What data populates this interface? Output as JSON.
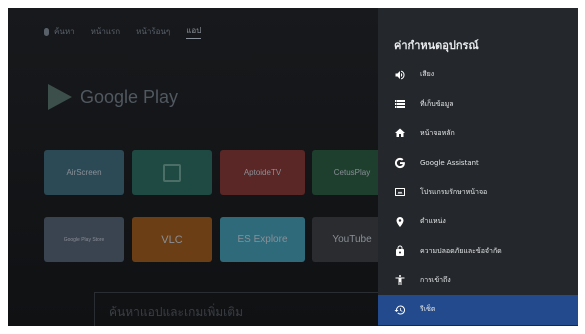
{
  "home": {
    "nav": {
      "search": "ค้นหา",
      "tabs": [
        "หน้าแรก",
        "หน้าร้อนๆ",
        "แอป"
      ]
    },
    "store_title": "Google Play",
    "apps_row1": [
      {
        "name": "AirScreen",
        "color": "#2c4a55"
      },
      {
        "name": "",
        "color": "#1f4a44"
      },
      {
        "name": "AptoideTV",
        "color": "#5a2626"
      },
      {
        "name": "CetusPlay",
        "color": "#1e3e2e"
      }
    ],
    "apps_row2": [
      {
        "name": "Google Play Store",
        "color": "#3a4350"
      },
      {
        "name": "VLC",
        "color": "#6b3e15"
      },
      {
        "name": "ES Explore",
        "color": "#2f6a7a"
      },
      {
        "name": "YouTube",
        "color": "#2a2c30"
      }
    ],
    "bottom_search": "ค้นหาแอปและเกมเพิ่มเติม"
  },
  "panel": {
    "title": "ค่ากำหนดอุปกรณ์",
    "items": [
      {
        "label": "เสียง",
        "icon": "speaker-icon"
      },
      {
        "label": "ที่เก็บข้อมูล",
        "icon": "storage-icon"
      },
      {
        "label": "หน้าจอหลัก",
        "icon": "home-icon"
      },
      {
        "label": "Google Assistant",
        "icon": "google-icon"
      },
      {
        "label": "โปรแกรมรักษาหน้าจอ",
        "icon": "screensaver-icon"
      },
      {
        "label": "ตำแหน่ง",
        "icon": "location-icon"
      },
      {
        "label": "ความปลอดภัยและข้อจำกัด",
        "icon": "lock-icon"
      },
      {
        "label": "การเข้าถึง",
        "icon": "accessibility-icon"
      },
      {
        "label": "รีเซ็ต",
        "icon": "reset-icon"
      }
    ],
    "selected_index": 8,
    "colors": {
      "panel_bg": "#24272b",
      "selected_bg": "#224a8c"
    }
  }
}
